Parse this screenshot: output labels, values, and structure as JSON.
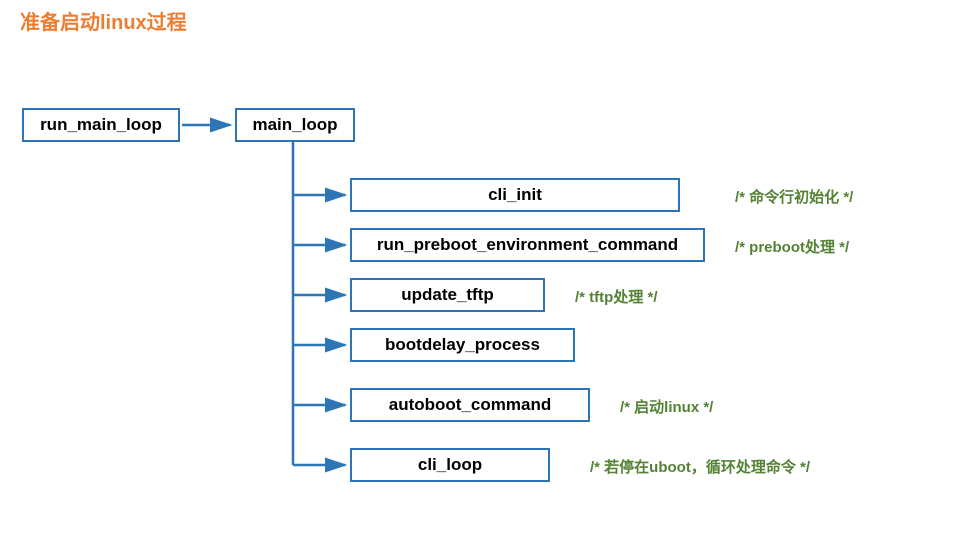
{
  "title": "准备启动linux过程",
  "boxes": {
    "run_main_loop": "run_main_loop",
    "main_loop": "main_loop",
    "cli_init": "cli_init",
    "run_preboot": "run_preboot_environment_command",
    "update_tftp": "update_tftp",
    "bootdelay_process": "bootdelay_process",
    "autoboot_command": "autoboot_command",
    "cli_loop": "cli_loop"
  },
  "comments": {
    "cli_init": "/* 命令行初始化 */",
    "preboot": "/* preboot处理 */",
    "tftp": "/* tftp处理 */",
    "autoboot": "/* 启动linux */",
    "cli_loop": "/* 若停在uboot，循环处理命令 */"
  },
  "chart_data": {
    "type": "flowchart",
    "title": "准备启动linux过程",
    "nodes": [
      {
        "id": "run_main_loop",
        "label": "run_main_loop"
      },
      {
        "id": "main_loop",
        "label": "main_loop"
      },
      {
        "id": "cli_init",
        "label": "cli_init",
        "comment": "/* 命令行初始化 */"
      },
      {
        "id": "run_preboot_environment_command",
        "label": "run_preboot_environment_command",
        "comment": "/* preboot处理 */"
      },
      {
        "id": "update_tftp",
        "label": "update_tftp",
        "comment": "/* tftp处理 */"
      },
      {
        "id": "bootdelay_process",
        "label": "bootdelay_process"
      },
      {
        "id": "autoboot_command",
        "label": "autoboot_command",
        "comment": "/* 启动linux */"
      },
      {
        "id": "cli_loop",
        "label": "cli_loop",
        "comment": "/* 若停在uboot，循环处理命令 */"
      }
    ],
    "edges": [
      {
        "from": "run_main_loop",
        "to": "main_loop"
      },
      {
        "from": "main_loop",
        "to": "cli_init"
      },
      {
        "from": "main_loop",
        "to": "run_preboot_environment_command"
      },
      {
        "from": "main_loop",
        "to": "update_tftp"
      },
      {
        "from": "main_loop",
        "to": "bootdelay_process"
      },
      {
        "from": "main_loop",
        "to": "autoboot_command"
      },
      {
        "from": "main_loop",
        "to": "cli_loop"
      }
    ]
  }
}
